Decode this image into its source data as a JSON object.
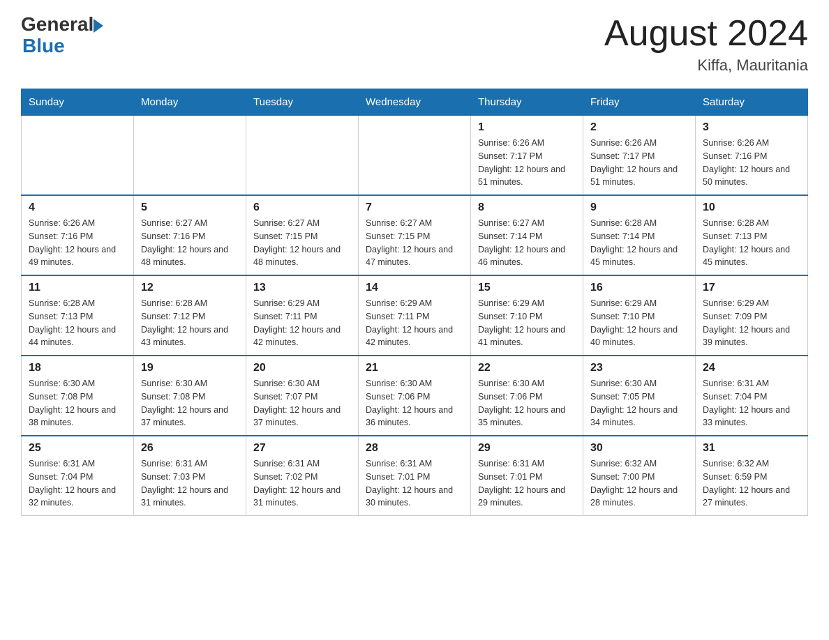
{
  "logo": {
    "general": "General",
    "blue": "Blue"
  },
  "title": "August 2024",
  "location": "Kiffa, Mauritania",
  "days_of_week": [
    "Sunday",
    "Monday",
    "Tuesday",
    "Wednesday",
    "Thursday",
    "Friday",
    "Saturday"
  ],
  "weeks": [
    [
      {
        "day": "",
        "info": ""
      },
      {
        "day": "",
        "info": ""
      },
      {
        "day": "",
        "info": ""
      },
      {
        "day": "",
        "info": ""
      },
      {
        "day": "1",
        "info": "Sunrise: 6:26 AM\nSunset: 7:17 PM\nDaylight: 12 hours and 51 minutes."
      },
      {
        "day": "2",
        "info": "Sunrise: 6:26 AM\nSunset: 7:17 PM\nDaylight: 12 hours and 51 minutes."
      },
      {
        "day": "3",
        "info": "Sunrise: 6:26 AM\nSunset: 7:16 PM\nDaylight: 12 hours and 50 minutes."
      }
    ],
    [
      {
        "day": "4",
        "info": "Sunrise: 6:26 AM\nSunset: 7:16 PM\nDaylight: 12 hours and 49 minutes."
      },
      {
        "day": "5",
        "info": "Sunrise: 6:27 AM\nSunset: 7:16 PM\nDaylight: 12 hours and 48 minutes."
      },
      {
        "day": "6",
        "info": "Sunrise: 6:27 AM\nSunset: 7:15 PM\nDaylight: 12 hours and 48 minutes."
      },
      {
        "day": "7",
        "info": "Sunrise: 6:27 AM\nSunset: 7:15 PM\nDaylight: 12 hours and 47 minutes."
      },
      {
        "day": "8",
        "info": "Sunrise: 6:27 AM\nSunset: 7:14 PM\nDaylight: 12 hours and 46 minutes."
      },
      {
        "day": "9",
        "info": "Sunrise: 6:28 AM\nSunset: 7:14 PM\nDaylight: 12 hours and 45 minutes."
      },
      {
        "day": "10",
        "info": "Sunrise: 6:28 AM\nSunset: 7:13 PM\nDaylight: 12 hours and 45 minutes."
      }
    ],
    [
      {
        "day": "11",
        "info": "Sunrise: 6:28 AM\nSunset: 7:13 PM\nDaylight: 12 hours and 44 minutes."
      },
      {
        "day": "12",
        "info": "Sunrise: 6:28 AM\nSunset: 7:12 PM\nDaylight: 12 hours and 43 minutes."
      },
      {
        "day": "13",
        "info": "Sunrise: 6:29 AM\nSunset: 7:11 PM\nDaylight: 12 hours and 42 minutes."
      },
      {
        "day": "14",
        "info": "Sunrise: 6:29 AM\nSunset: 7:11 PM\nDaylight: 12 hours and 42 minutes."
      },
      {
        "day": "15",
        "info": "Sunrise: 6:29 AM\nSunset: 7:10 PM\nDaylight: 12 hours and 41 minutes."
      },
      {
        "day": "16",
        "info": "Sunrise: 6:29 AM\nSunset: 7:10 PM\nDaylight: 12 hours and 40 minutes."
      },
      {
        "day": "17",
        "info": "Sunrise: 6:29 AM\nSunset: 7:09 PM\nDaylight: 12 hours and 39 minutes."
      }
    ],
    [
      {
        "day": "18",
        "info": "Sunrise: 6:30 AM\nSunset: 7:08 PM\nDaylight: 12 hours and 38 minutes."
      },
      {
        "day": "19",
        "info": "Sunrise: 6:30 AM\nSunset: 7:08 PM\nDaylight: 12 hours and 37 minutes."
      },
      {
        "day": "20",
        "info": "Sunrise: 6:30 AM\nSunset: 7:07 PM\nDaylight: 12 hours and 37 minutes."
      },
      {
        "day": "21",
        "info": "Sunrise: 6:30 AM\nSunset: 7:06 PM\nDaylight: 12 hours and 36 minutes."
      },
      {
        "day": "22",
        "info": "Sunrise: 6:30 AM\nSunset: 7:06 PM\nDaylight: 12 hours and 35 minutes."
      },
      {
        "day": "23",
        "info": "Sunrise: 6:30 AM\nSunset: 7:05 PM\nDaylight: 12 hours and 34 minutes."
      },
      {
        "day": "24",
        "info": "Sunrise: 6:31 AM\nSunset: 7:04 PM\nDaylight: 12 hours and 33 minutes."
      }
    ],
    [
      {
        "day": "25",
        "info": "Sunrise: 6:31 AM\nSunset: 7:04 PM\nDaylight: 12 hours and 32 minutes."
      },
      {
        "day": "26",
        "info": "Sunrise: 6:31 AM\nSunset: 7:03 PM\nDaylight: 12 hours and 31 minutes."
      },
      {
        "day": "27",
        "info": "Sunrise: 6:31 AM\nSunset: 7:02 PM\nDaylight: 12 hours and 31 minutes."
      },
      {
        "day": "28",
        "info": "Sunrise: 6:31 AM\nSunset: 7:01 PM\nDaylight: 12 hours and 30 minutes."
      },
      {
        "day": "29",
        "info": "Sunrise: 6:31 AM\nSunset: 7:01 PM\nDaylight: 12 hours and 29 minutes."
      },
      {
        "day": "30",
        "info": "Sunrise: 6:32 AM\nSunset: 7:00 PM\nDaylight: 12 hours and 28 minutes."
      },
      {
        "day": "31",
        "info": "Sunrise: 6:32 AM\nSunset: 6:59 PM\nDaylight: 12 hours and 27 minutes."
      }
    ]
  ]
}
